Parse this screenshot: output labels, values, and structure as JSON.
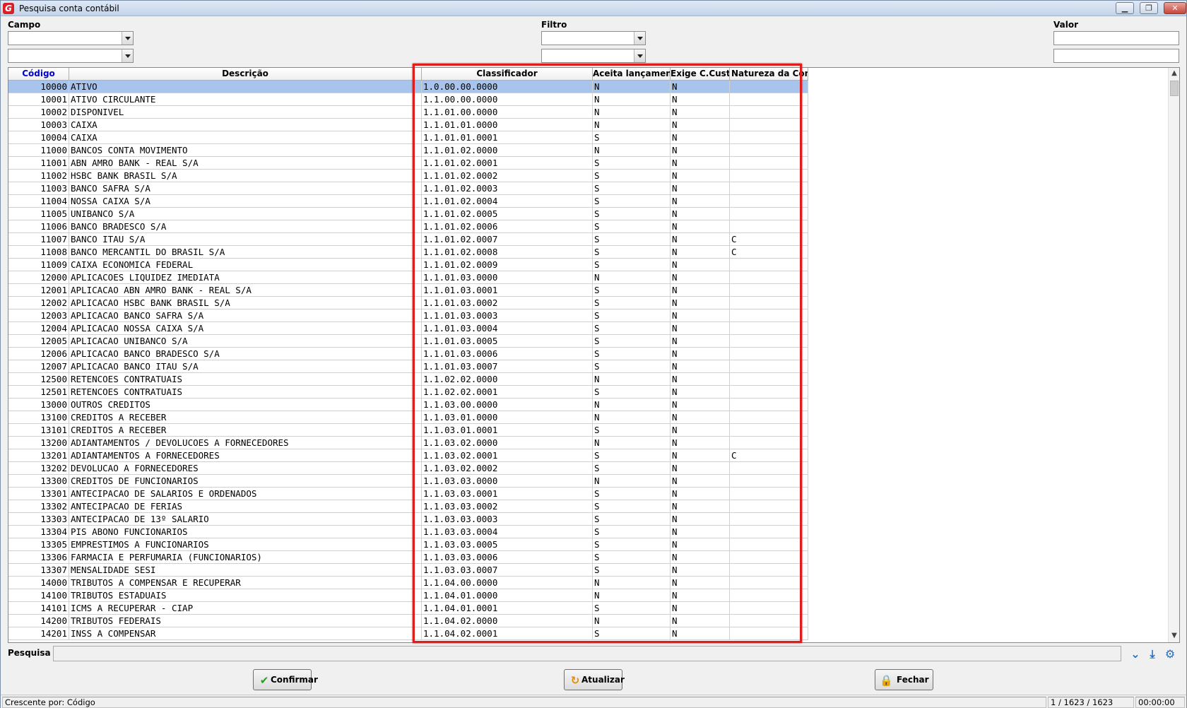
{
  "window": {
    "title": "Pesquisa conta contábil",
    "min": "▁",
    "max": "❐",
    "close": "✕"
  },
  "filters": {
    "campo_label": "Campo",
    "filtro_label": "Filtro",
    "valor_label": "Valor"
  },
  "grid": {
    "columns": [
      "Código",
      "Descrição",
      "Classificador",
      "Aceita lançamento",
      "Exige C.Custo",
      "Natureza da Conta"
    ],
    "rows": [
      [
        "10000",
        "ATIVO",
        "1.0.00.00.0000",
        "N",
        "N",
        ""
      ],
      [
        "10001",
        "ATIVO CIRCULANTE",
        "1.1.00.00.0000",
        "N",
        "N",
        ""
      ],
      [
        "10002",
        "DISPONIVEL",
        "1.1.01.00.0000",
        "N",
        "N",
        ""
      ],
      [
        "10003",
        "CAIXA",
        "1.1.01.01.0000",
        "N",
        "N",
        ""
      ],
      [
        "10004",
        "CAIXA",
        "1.1.01.01.0001",
        "S",
        "N",
        ""
      ],
      [
        "11000",
        "BANCOS CONTA MOVIMENTO",
        "1.1.01.02.0000",
        "N",
        "N",
        ""
      ],
      [
        "11001",
        "ABN AMRO BANK - REAL S/A",
        "1.1.01.02.0001",
        "S",
        "N",
        ""
      ],
      [
        "11002",
        "HSBC BANK BRASIL S/A",
        "1.1.01.02.0002",
        "S",
        "N",
        ""
      ],
      [
        "11003",
        "BANCO SAFRA S/A",
        "1.1.01.02.0003",
        "S",
        "N",
        ""
      ],
      [
        "11004",
        "NOSSA CAIXA S/A",
        "1.1.01.02.0004",
        "S",
        "N",
        ""
      ],
      [
        "11005",
        "UNIBANCO S/A",
        "1.1.01.02.0005",
        "S",
        "N",
        ""
      ],
      [
        "11006",
        "BANCO BRADESCO S/A",
        "1.1.01.02.0006",
        "S",
        "N",
        ""
      ],
      [
        "11007",
        "BANCO ITAU S/A",
        "1.1.01.02.0007",
        "S",
        "N",
        "C"
      ],
      [
        "11008",
        "BANCO MERCANTIL DO BRASIL S/A",
        "1.1.01.02.0008",
        "S",
        "N",
        "C"
      ],
      [
        "11009",
        "CAIXA ECONOMICA FEDERAL",
        "1.1.01.02.0009",
        "S",
        "N",
        ""
      ],
      [
        "12000",
        "APLICACOES LIQUIDEZ IMEDIATA",
        "1.1.01.03.0000",
        "N",
        "N",
        ""
      ],
      [
        "12001",
        "APLICACAO ABN AMRO BANK - REAL S/A",
        "1.1.01.03.0001",
        "S",
        "N",
        ""
      ],
      [
        "12002",
        "APLICACAO HSBC BANK BRASIL S/A",
        "1.1.01.03.0002",
        "S",
        "N",
        ""
      ],
      [
        "12003",
        "APLICACAO BANCO SAFRA S/A",
        "1.1.01.03.0003",
        "S",
        "N",
        ""
      ],
      [
        "12004",
        "APLICACAO NOSSA CAIXA S/A",
        "1.1.01.03.0004",
        "S",
        "N",
        ""
      ],
      [
        "12005",
        "APLICACAO UNIBANCO S/A",
        "1.1.01.03.0005",
        "S",
        "N",
        ""
      ],
      [
        "12006",
        "APLICACAO BANCO BRADESCO S/A",
        "1.1.01.03.0006",
        "S",
        "N",
        ""
      ],
      [
        "12007",
        "APLICACAO BANCO ITAU S/A",
        "1.1.01.03.0007",
        "S",
        "N",
        ""
      ],
      [
        "12500",
        "RETENCOES CONTRATUAIS",
        "1.1.02.02.0000",
        "N",
        "N",
        ""
      ],
      [
        "12501",
        "RETENCOES CONTRATUAIS",
        "1.1.02.02.0001",
        "S",
        "N",
        ""
      ],
      [
        "13000",
        "OUTROS CREDITOS",
        "1.1.03.00.0000",
        "N",
        "N",
        ""
      ],
      [
        "13100",
        "CREDITOS A RECEBER",
        "1.1.03.01.0000",
        "N",
        "N",
        ""
      ],
      [
        "13101",
        "CREDITOS A RECEBER",
        "1.1.03.01.0001",
        "S",
        "N",
        ""
      ],
      [
        "13200",
        "ADIANTAMENTOS / DEVOLUCOES A FORNECEDORES",
        "1.1.03.02.0000",
        "N",
        "N",
        ""
      ],
      [
        "13201",
        "ADIANTAMENTOS A FORNECEDORES",
        "1.1.03.02.0001",
        "S",
        "N",
        "C"
      ],
      [
        "13202",
        "DEVOLUCAO A FORNECEDORES",
        "1.1.03.02.0002",
        "S",
        "N",
        ""
      ],
      [
        "13300",
        "CREDITOS DE FUNCIONARIOS",
        "1.1.03.03.0000",
        "N",
        "N",
        ""
      ],
      [
        "13301",
        "ANTECIPACAO DE SALARIOS E ORDENADOS",
        "1.1.03.03.0001",
        "S",
        "N",
        ""
      ],
      [
        "13302",
        "ANTECIPACAO DE FERIAS",
        "1.1.03.03.0002",
        "S",
        "N",
        ""
      ],
      [
        "13303",
        "ANTECIPACAO DE 13º SALARIO",
        "1.1.03.03.0003",
        "S",
        "N",
        ""
      ],
      [
        "13304",
        "PIS ABONO FUNCIONARIOS",
        "1.1.03.03.0004",
        "S",
        "N",
        ""
      ],
      [
        "13305",
        "EMPRESTIMOS A FUNCIONARIOS",
        "1.1.03.03.0005",
        "S",
        "N",
        ""
      ],
      [
        "13306",
        "FARMACIA E PERFUMARIA (FUNCIONARIOS)",
        "1.1.03.03.0006",
        "S",
        "N",
        ""
      ],
      [
        "13307",
        "MENSALIDADE SESI",
        "1.1.03.03.0007",
        "S",
        "N",
        ""
      ],
      [
        "14000",
        "TRIBUTOS A COMPENSAR E RECUPERAR",
        "1.1.04.00.0000",
        "N",
        "N",
        ""
      ],
      [
        "14100",
        "TRIBUTOS ESTADUAIS",
        "1.1.04.01.0000",
        "N",
        "N",
        ""
      ],
      [
        "14101",
        "ICMS A RECUPERAR - CIAP",
        "1.1.04.01.0001",
        "S",
        "N",
        ""
      ],
      [
        "14200",
        "TRIBUTOS FEDERAIS",
        "1.1.04.02.0000",
        "N",
        "N",
        ""
      ],
      [
        "14201",
        "INSS A COMPENSAR",
        "1.1.04.02.0001",
        "S",
        "N",
        ""
      ]
    ]
  },
  "search": {
    "label": "Pesquisa",
    "value": ""
  },
  "buttons": {
    "confirm": "Confirmar",
    "refresh": "Atualizar",
    "close": "Fechar"
  },
  "status": {
    "sort": "Crescente por: Código",
    "position": "1 / 1623 / 1623",
    "time": "00:00:00"
  },
  "colors": {
    "header_code": "#0000cc",
    "selection": "#a8c4ec",
    "highlight_box": "#e01d1d"
  }
}
